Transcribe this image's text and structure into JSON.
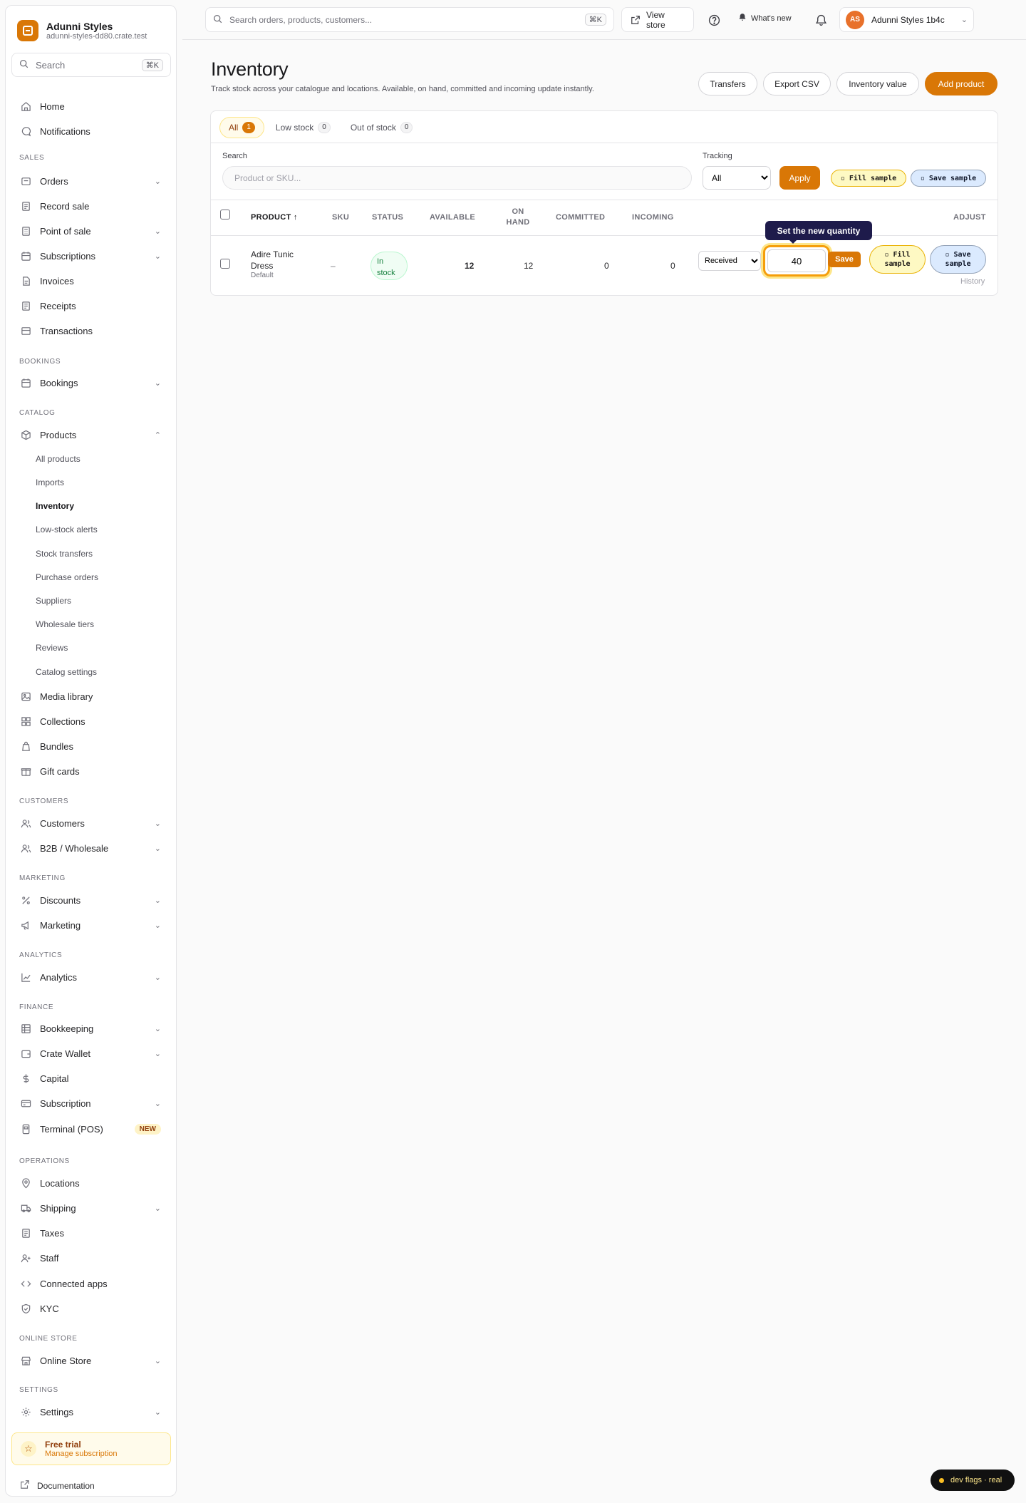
{
  "brand": {
    "name": "Adunni Styles",
    "domain": "adunni-styles-dd80.crate.test"
  },
  "sidebar_search": {
    "placeholder": "Search",
    "shortcut": "⌘K"
  },
  "nav": {
    "home": "Home",
    "notifications": "Notifications",
    "sec_sales": "SALES",
    "orders": "Orders",
    "record_sale": "Record sale",
    "point_of_sale": "Point of sale",
    "subscriptions": "Subscriptions",
    "invoices": "Invoices",
    "receipts": "Receipts",
    "transactions": "Transactions",
    "sec_bookings": "BOOKINGS",
    "bookings": "Bookings",
    "sec_catalog": "CATALOG",
    "products": "Products",
    "products_sub": [
      "All products",
      "Imports",
      "Inventory",
      "Low-stock alerts",
      "Stock transfers",
      "Purchase orders",
      "Suppliers",
      "Wholesale tiers",
      "Reviews",
      "Catalog settings"
    ],
    "media_library": "Media library",
    "collections": "Collections",
    "bundles": "Bundles",
    "gift_cards": "Gift cards",
    "sec_customers": "CUSTOMERS",
    "customers": "Customers",
    "b2b": "B2B / Wholesale",
    "sec_marketing": "MARKETING",
    "discounts": "Discounts",
    "marketing": "Marketing",
    "sec_analytics": "ANALYTICS",
    "analytics": "Analytics",
    "sec_finance": "FINANCE",
    "bookkeeping": "Bookkeeping",
    "crate_wallet": "Crate Wallet",
    "capital": "Capital",
    "subscription": "Subscription",
    "terminal": "Terminal (POS)",
    "terminal_badge": "NEW",
    "sec_operations": "OPERATIONS",
    "locations": "Locations",
    "shipping": "Shipping",
    "taxes": "Taxes",
    "staff": "Staff",
    "connected_apps": "Connected apps",
    "kyc": "KYC",
    "sec_online_store": "ONLINE STORE",
    "online_store": "Online Store",
    "sec_settings": "SETTINGS",
    "settings": "Settings"
  },
  "trial": {
    "title": "Free trial",
    "subtitle": "Manage subscription"
  },
  "documentation": "Documentation",
  "topbar": {
    "search_placeholder": "Search orders, products, customers...",
    "search_shortcut": "⌘K",
    "view_store": "View store",
    "whats_new": "What's new",
    "account_initials": "AS",
    "account_name": "Adunni Styles 1b4c"
  },
  "page": {
    "title": "Inventory",
    "subtitle": "Track stock across your catalogue and locations. Available, on hand, committed and incoming update instantly.",
    "actions": {
      "transfers": "Transfers",
      "export_csv": "Export CSV",
      "inventory_value": "Inventory value",
      "add_product": "Add product"
    }
  },
  "tabs": [
    {
      "label": "All",
      "count": "1"
    },
    {
      "label": "Low stock",
      "count": "0"
    },
    {
      "label": "Out of stock",
      "count": "0"
    }
  ],
  "filters": {
    "search_label": "Search",
    "search_placeholder": "Product or SKU...",
    "tracking_label": "Tracking",
    "tracking_value": "All",
    "apply": "Apply",
    "fill_sample": "▫ Fill sample",
    "save_sample": "▫ Save sample"
  },
  "table": {
    "headers": {
      "product": "PRODUCT ↑",
      "sku": "SKU",
      "status": "STATUS",
      "available": "AVAILABLE",
      "on_hand_1": "ON",
      "on_hand_2": "HAND",
      "committed": "COMMITTED",
      "incoming": "INCOMING",
      "adjust": "ADJUST"
    },
    "row": {
      "name_1": "Adire Tunic",
      "name_2": "Dress",
      "variant": "Default",
      "sku": "–",
      "status_1": "In",
      "status_2": "stock",
      "available": "12",
      "on_hand": "12",
      "committed": "0",
      "incoming": "0",
      "reason": "Received",
      "quantity": "40",
      "save": "Save",
      "fill_1": "▫ Fill",
      "fill_2": "sample",
      "save_sample_1": "▫ Save",
      "save_sample_2": "sample",
      "history": "History"
    },
    "tooltip": "Set the new quantity"
  },
  "dev_flags": "dev flags · real",
  "colors": {
    "accent": "#d97706",
    "success": "#15803d",
    "tooltip": "#1e1b4b"
  }
}
